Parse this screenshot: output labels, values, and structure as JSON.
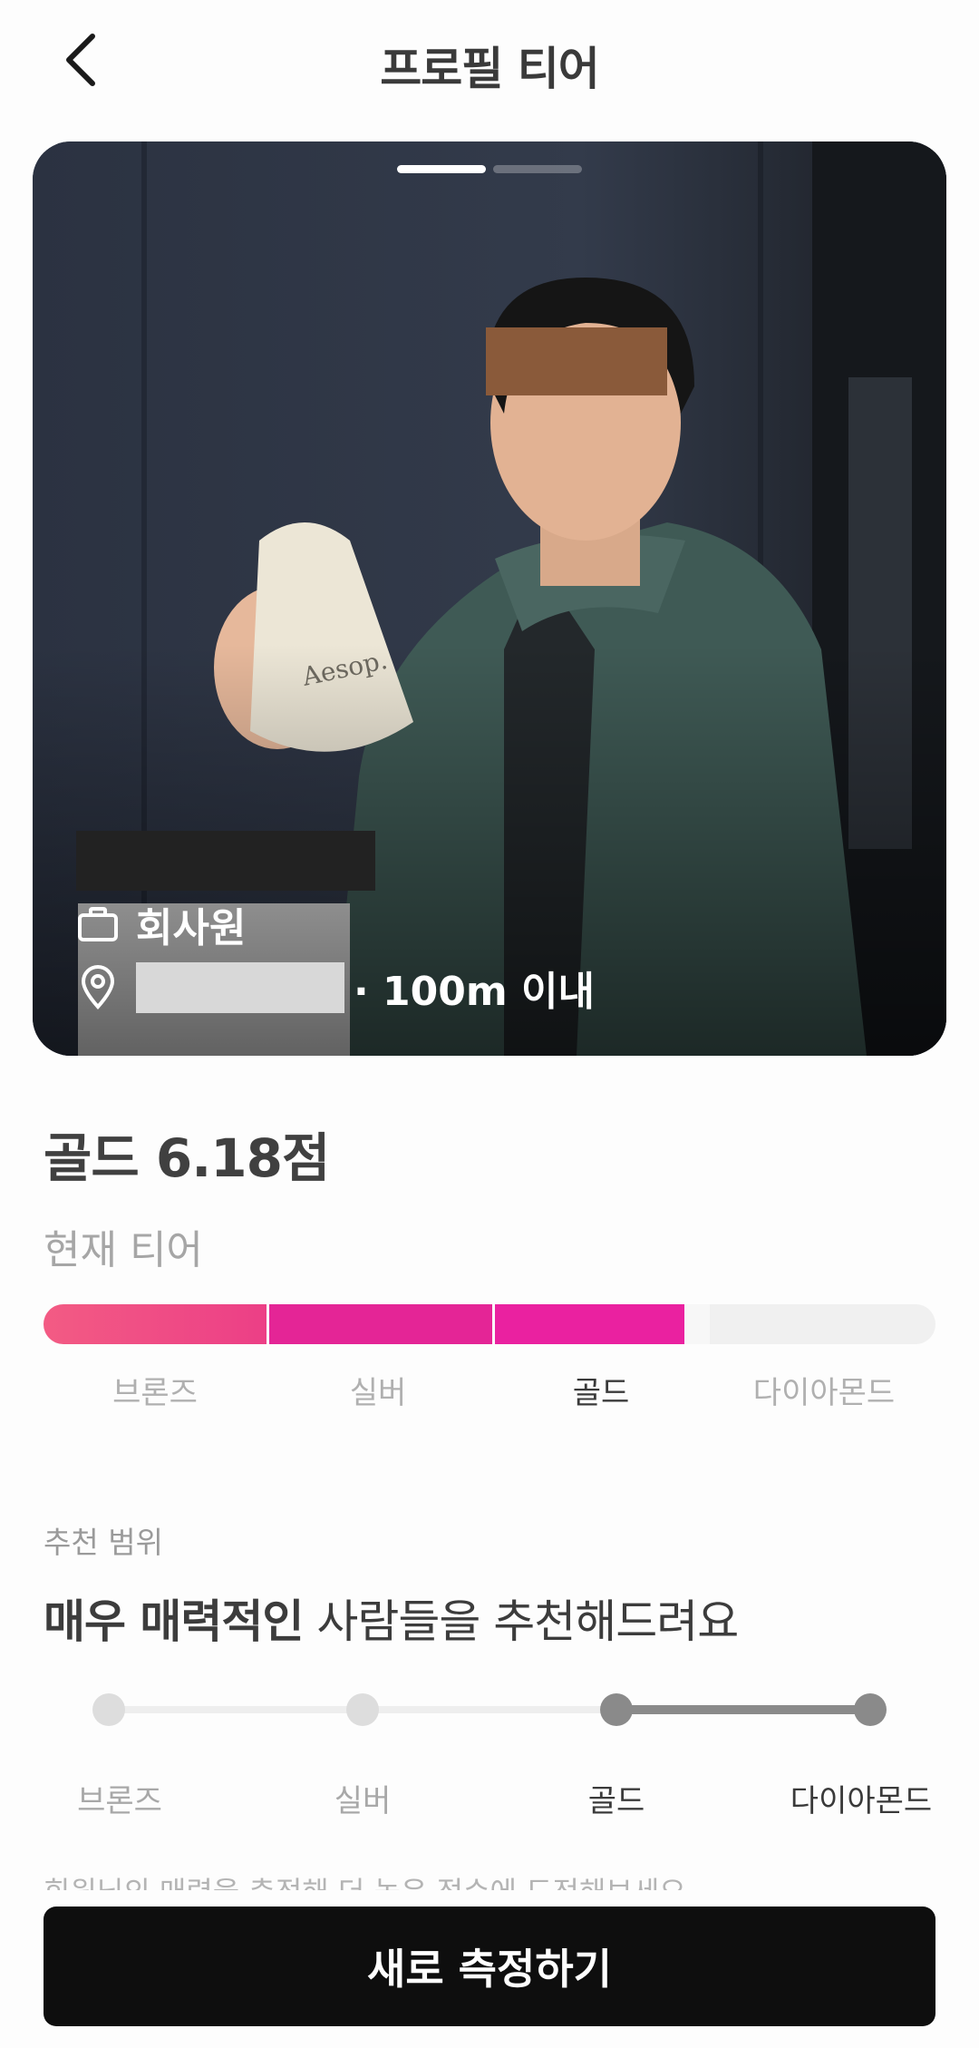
{
  "header": {
    "title": "프로필 티어",
    "back_icon": "chevron-left-icon"
  },
  "profile_card": {
    "pager": {
      "total": 2,
      "active": 1
    },
    "job_icon": "briefcase-icon",
    "job": "회사원",
    "location_icon": "map-pin-icon",
    "distance": "· 100m 이내"
  },
  "tier": {
    "title": "골드 6.18점",
    "subtitle": "현재 티어",
    "progress_fraction": 0.712,
    "levels": [
      "브론즈",
      "실버",
      "골드",
      "다이아몬드"
    ],
    "active_index": 2,
    "colors": {
      "bronze": "#f35b84",
      "silver": "#e42596",
      "gold": "#ea21a0",
      "empty": "#f0f0f0"
    }
  },
  "recommendation": {
    "label": "추천 범위",
    "sentence_bold": "매우 매력적인",
    "sentence_rest": " 사람들을 추천해드려요",
    "levels": [
      "브론즈",
      "실버",
      "골드",
      "다이아몬드"
    ],
    "range_start_index": 2,
    "range_end_index": 3,
    "hint": "회원님의 매력을 측정해 더 높은 점수에 도전해보세요"
  },
  "cta": {
    "label": "새로 측정하기"
  }
}
